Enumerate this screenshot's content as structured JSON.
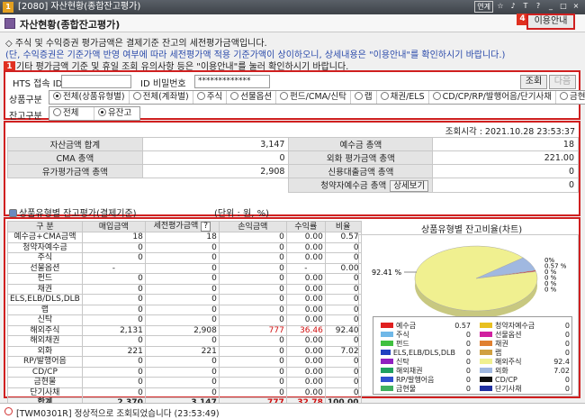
{
  "window": {
    "number": "1",
    "title": "[2080] 자산현황(종합잔고평가)",
    "buttons": [
      "연계",
      "☆",
      "♪",
      "T",
      "?",
      "_",
      "□",
      "×"
    ]
  },
  "header": {
    "title": "자산현황(종합잔고평가)",
    "info_button": "이용안내",
    "badge4": "4"
  },
  "notes": {
    "line1": "◇ 주식 및 수익증권 평가금액은 결제기준 잔고의 세전평가금액입니다.",
    "line2": "(단, 수익증권은 기준가액 반영 여부에 따라 세전평가액 적용 기준가액이 상이하오니, 상세내용은 \"이용안내\"를 확인하시기 바랍니다.)",
    "line3": "기타 평가금액 기준 및 휴일 조회 유의사항 등은 \"이용안내\"를 눌러 확인하시기 바랍니다."
  },
  "badges": {
    "b1": "1",
    "b2": "2",
    "b3": "3"
  },
  "query": {
    "hts_label": "HTS 접속 ID",
    "hts_value": "",
    "pw_label": "ID 비밀번호",
    "pw_value": "*************",
    "btn_query": "조회",
    "btn_next": "다음",
    "prod_label": "상품구분",
    "prod_options": [
      "전체(상품유형별)",
      "전체(계좌별)",
      "주식",
      "선물옵션",
      "펀드/CMA/신탁",
      "랩",
      "채권/ELS",
      "CD/CP/RP/발행어음/단기사채",
      "금현물"
    ],
    "bal_label": "잔고구분",
    "bal_options": [
      "전체",
      "유잔고"
    ]
  },
  "summary": {
    "timestamp": "조회시각 : 2021.10.28 23:53:37",
    "rows": [
      [
        "자산금액 합계",
        "3,147",
        "예수금 총액",
        "18"
      ],
      [
        "CMA 총액",
        "0",
        "외화 평가금액 총액",
        "221.00"
      ],
      [
        "유가평가금액 총액",
        "2,908",
        "신용대출금액 총액",
        "0"
      ]
    ],
    "sub_label": "청약자예수금 총액",
    "sub_button": "상세보기",
    "sub_value": "0",
    "section_title": "상품유형별 잔고평가(결제기준)",
    "unit": "(단위 : 원, %)"
  },
  "detail": {
    "headers": [
      "구    분",
      "매입금액",
      "세전평가금액",
      "?",
      "손익금액",
      "수익률",
      "비율"
    ],
    "rows": [
      [
        "예수금+CMA금액",
        "18",
        "18",
        "0",
        "0.00",
        "0.57"
      ],
      [
        "청약자예수금",
        "0",
        "0",
        "0",
        "0.00",
        "0"
      ],
      [
        "주식",
        "0",
        "0",
        "0",
        "0.00",
        "0"
      ],
      [
        "선물옵션",
        "-",
        "0",
        "0",
        "-",
        "0.00"
      ],
      [
        "펀드",
        "0",
        "0",
        "0",
        "0.00",
        "0"
      ],
      [
        "채권",
        "0",
        "0",
        "0",
        "0.00",
        "0"
      ],
      [
        "ELS,ELB/DLS,DLB",
        "0",
        "0",
        "0",
        "0.00",
        "0"
      ],
      [
        "랩",
        "0",
        "0",
        "0",
        "0.00",
        "0"
      ],
      [
        "신탁",
        "0",
        "0",
        "0",
        "0.00",
        "0"
      ],
      [
        "해외주식",
        "2,131",
        "2,908",
        "777",
        "36.46",
        "92.40"
      ],
      [
        "해외채권",
        "0",
        "0",
        "0",
        "0.00",
        "0"
      ],
      [
        "외화",
        "221",
        "221",
        "0",
        "0.00",
        "7.02"
      ],
      [
        "RP/발행어음",
        "0",
        "0",
        "0",
        "0.00",
        "0"
      ],
      [
        "CD/CP",
        "0",
        "0",
        "0",
        "0.00",
        "0"
      ],
      [
        "금현물",
        "0",
        "0",
        "0",
        "0.00",
        "0"
      ],
      [
        "단기사채",
        "0",
        "0",
        "0",
        "0.00",
        "0"
      ]
    ],
    "total": [
      "합계",
      "2,370",
      "3,147",
      "777",
      "32.78",
      "100.00"
    ]
  },
  "chart": {
    "title": "상품유형별 잔고비율(차트)",
    "big_label": "92.41 %",
    "small_labels": [
      "0%",
      "0.57 %",
      "0 %",
      "0 %",
      "0 %",
      "0 %"
    ],
    "legend": [
      {
        "name": "예수금",
        "value": "0.57",
        "color": "#e02020"
      },
      {
        "name": "청약자예수금",
        "value": "0",
        "color": "#e8c020"
      },
      {
        "name": "주식",
        "value": "0",
        "color": "#70b8e8"
      },
      {
        "name": "선물옵션",
        "value": "0",
        "color": "#d020a0"
      },
      {
        "name": "펀드",
        "value": "0",
        "color": "#40c040"
      },
      {
        "name": "채권",
        "value": "0",
        "color": "#e08030"
      },
      {
        "name": "ELS,ELB/DLS,DLB",
        "value": "0",
        "color": "#2040c0"
      },
      {
        "name": "랩",
        "value": "0",
        "color": "#d0a040"
      },
      {
        "name": "신탁",
        "value": "0",
        "color": "#9020c0"
      },
      {
        "name": "해외주식",
        "value": "92.4",
        "color": "#f0f090"
      },
      {
        "name": "해외채권",
        "value": "0",
        "color": "#20a060"
      },
      {
        "name": "외화",
        "value": "7.02",
        "color": "#a0b8e0"
      },
      {
        "name": "RP/발행어음",
        "value": "0",
        "color": "#3050d0"
      },
      {
        "name": "CD/CP",
        "value": "0",
        "color": "#101010"
      },
      {
        "name": "금현물",
        "value": "0",
        "color": "#40b060"
      },
      {
        "name": "단기사채",
        "value": "0",
        "color": "#2030a0"
      }
    ]
  },
  "chart_data": {
    "type": "pie",
    "categories": [
      "예수금",
      "청약자예수금",
      "주식",
      "선물옵션",
      "펀드",
      "채권",
      "ELS,ELB/DLS,DLB",
      "랩",
      "신탁",
      "해외주식",
      "해외채권",
      "외화",
      "RP/발행어음",
      "CD/CP",
      "금현물",
      "단기사채"
    ],
    "values": [
      0.57,
      0,
      0,
      0,
      0,
      0,
      0,
      0,
      0,
      92.41,
      0,
      7.02,
      0,
      0,
      0,
      0
    ],
    "title": "상품유형별 잔고비율(차트)"
  },
  "status": {
    "text": "[TWM0301R] 정상적으로 조회되었습니다 (23:53:49)"
  }
}
